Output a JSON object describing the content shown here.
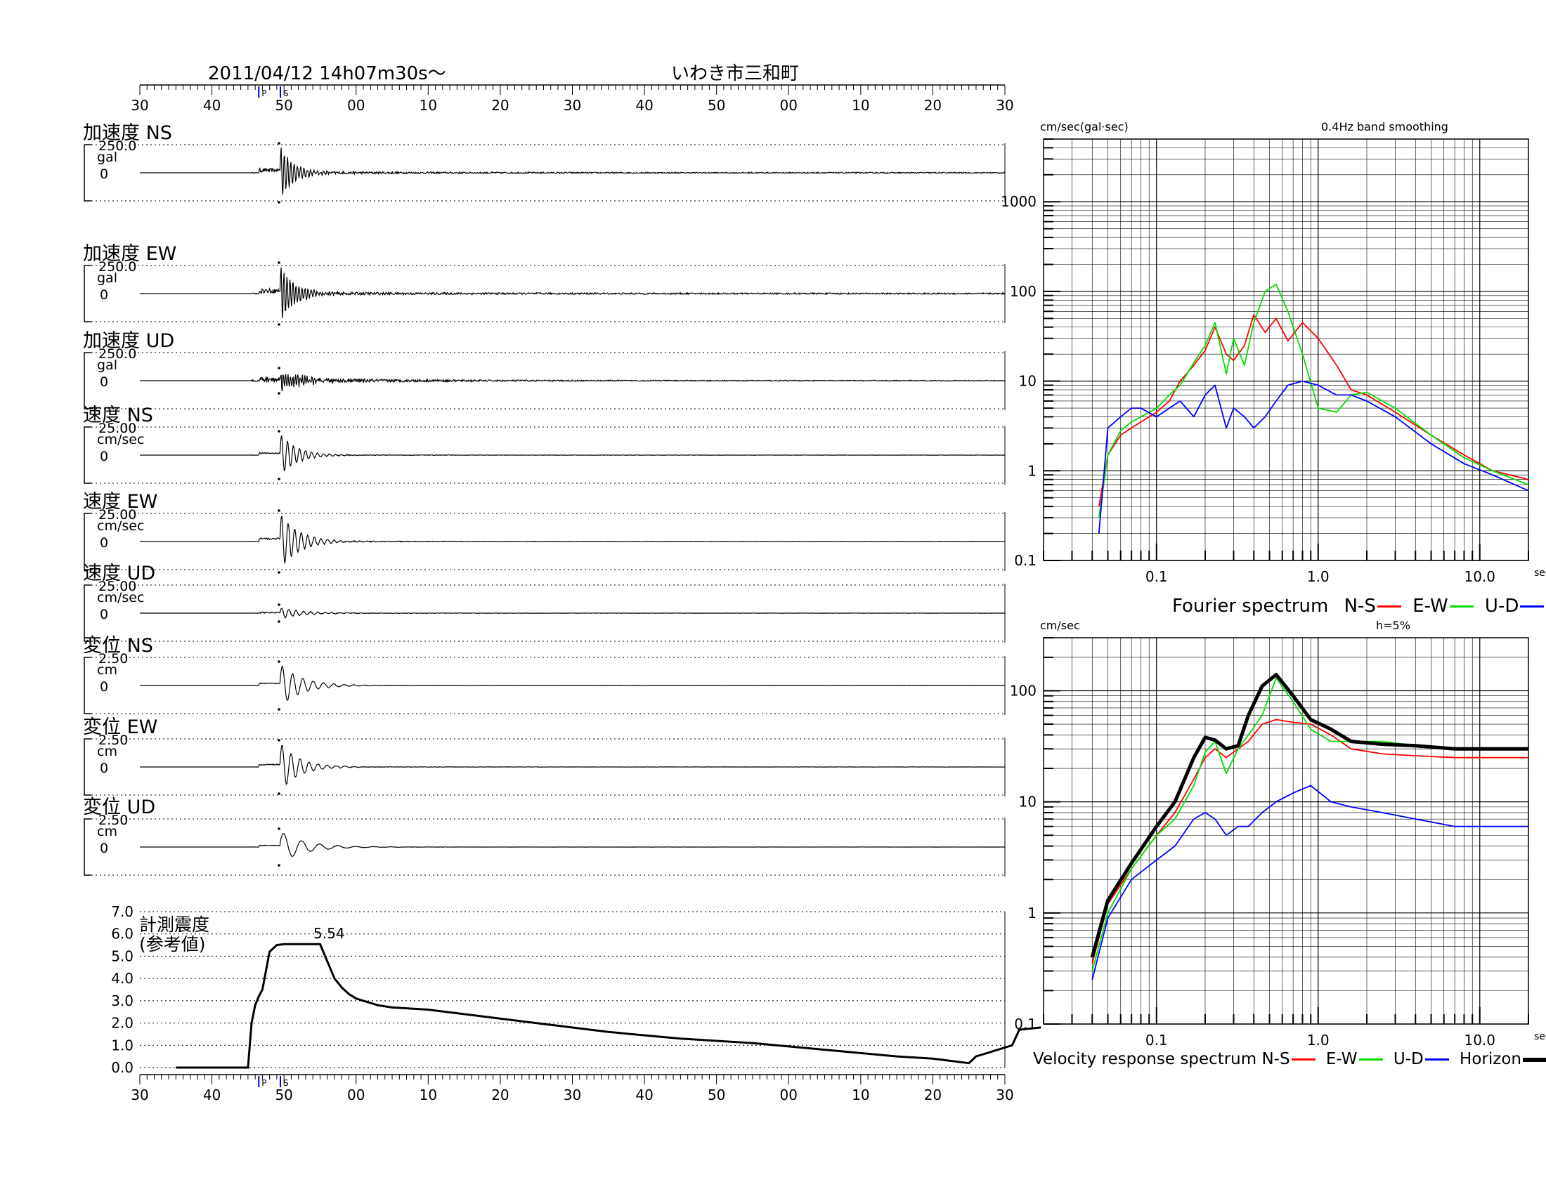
{
  "header": {
    "datetime": "2011/04/12  14h07m30s〜",
    "station": "いわき市三和町"
  },
  "time_axis": {
    "tick_labels": [
      "30",
      "40",
      "50",
      "00",
      "10",
      "20",
      "30",
      "40",
      "50",
      "00",
      "10",
      "20",
      "30"
    ],
    "p_marker": "P",
    "s_marker": "S"
  },
  "traces": [
    {
      "label": "加速度 NS",
      "scale": "250.0",
      "unit": "gal",
      "zero": "0"
    },
    {
      "label": "加速度 EW",
      "scale": "250.0",
      "unit": "gal",
      "zero": "0"
    },
    {
      "label": "加速度 UD",
      "scale": "250.0",
      "unit": "gal",
      "zero": "0"
    },
    {
      "label": "速度 NS",
      "scale": "25.00",
      "unit": "cm/sec",
      "zero": "0"
    },
    {
      "label": "速度 EW",
      "scale": "25.00",
      "unit": "cm/sec",
      "zero": "0"
    },
    {
      "label": "速度 UD",
      "scale": "25.00",
      "unit": "cm/sec",
      "zero": "0"
    },
    {
      "label": "変位 NS",
      "scale": "2.50",
      "unit": "cm",
      "zero": "0"
    },
    {
      "label": "変位 EW",
      "scale": "2.50",
      "unit": "cm",
      "zero": "0"
    },
    {
      "label": "変位 UD",
      "scale": "2.50",
      "unit": "cm",
      "zero": "0"
    }
  ],
  "intensity": {
    "label_line1": "計測震度",
    "label_line2": "(参考値)",
    "peak_label": "5.54",
    "y_ticks": [
      "7.0",
      "6.0",
      "5.0",
      "4.0",
      "3.0",
      "2.0",
      "1.0",
      "0.0"
    ]
  },
  "fourier": {
    "ylabel": "cm/sec(gal·sec)",
    "note": "0.4Hz band smoothing",
    "y_ticks": [
      "1000",
      "100",
      "10",
      "1",
      "0.1"
    ],
    "x_ticks": [
      "0.1",
      "1.0",
      "10.0"
    ],
    "x_unit": "sec",
    "legend_title": "Fourier spectrum",
    "legend": [
      "N-S",
      "E-W",
      "U-D"
    ]
  },
  "response": {
    "ylabel": "cm/sec",
    "note": "h=5%",
    "y_ticks": [
      "100",
      "10",
      "1",
      "0.1"
    ],
    "x_ticks": [
      "0.1",
      "1.0",
      "10.0"
    ],
    "x_unit": "sec",
    "legend_title": "Velocity response spectrum",
    "legend": [
      "N-S",
      "E-W",
      "U-D",
      "Horizon"
    ]
  },
  "colors": {
    "ns": "#ff0000",
    "ew": "#00e000",
    "ud": "#0000ff",
    "horizon": "#000000",
    "markers": "#0000cc"
  },
  "chart_data": [
    {
      "type": "line",
      "title": "Fourier spectrum",
      "ylabel": "cm/sec(gal·sec)",
      "xlabel": "sec",
      "xscale": "log",
      "yscale": "log",
      "xlim": [
        0.02,
        20
      ],
      "ylim": [
        0.1,
        5000
      ],
      "series": [
        {
          "name": "N-S",
          "x": [
            0.044,
            0.05,
            0.06,
            0.07,
            0.08,
            0.1,
            0.12,
            0.14,
            0.17,
            0.2,
            0.23,
            0.27,
            0.3,
            0.35,
            0.4,
            0.47,
            0.55,
            0.65,
            0.8,
            1.0,
            1.3,
            1.6,
            2,
            3,
            5,
            8,
            12,
            20
          ],
          "y": [
            0.4,
            1.5,
            2.5,
            3.0,
            3.5,
            4.5,
            6,
            10,
            15,
            22,
            40,
            20,
            17,
            25,
            55,
            35,
            50,
            28,
            45,
            30,
            15,
            8,
            7,
            4.5,
            2.5,
            1.5,
            1.0,
            0.8
          ]
        },
        {
          "name": "E-W",
          "x": [
            0.044,
            0.05,
            0.06,
            0.07,
            0.08,
            0.1,
            0.12,
            0.14,
            0.17,
            0.2,
            0.23,
            0.27,
            0.3,
            0.35,
            0.4,
            0.47,
            0.55,
            0.65,
            0.8,
            1.0,
            1.3,
            1.6,
            2,
            3,
            5,
            8,
            12,
            20
          ],
          "y": [
            0.3,
            1.5,
            2.8,
            3.5,
            4,
            5,
            7,
            9,
            16,
            25,
            45,
            12,
            30,
            15,
            45,
            100,
            120,
            60,
            20,
            5,
            4.5,
            7,
            7.5,
            5,
            2.5,
            1.4,
            1.0,
            0.7
          ]
        },
        {
          "name": "U-D",
          "x": [
            0.044,
            0.05,
            0.06,
            0.07,
            0.08,
            0.1,
            0.12,
            0.14,
            0.17,
            0.2,
            0.23,
            0.27,
            0.3,
            0.35,
            0.4,
            0.47,
            0.55,
            0.65,
            0.8,
            1.0,
            1.3,
            1.6,
            2,
            3,
            5,
            8,
            12,
            20
          ],
          "y": [
            0.2,
            3,
            4,
            5,
            5,
            4,
            5,
            6,
            4,
            7,
            9,
            3,
            5,
            4,
            3,
            4,
            6,
            9,
            10,
            9,
            7,
            7,
            6,
            4,
            2,
            1.2,
            0.9,
            0.6
          ]
        }
      ]
    },
    {
      "type": "line",
      "title": "Velocity response spectrum",
      "ylabel": "cm/sec",
      "xlabel": "sec",
      "note": "h=5%",
      "xscale": "log",
      "yscale": "log",
      "xlim": [
        0.02,
        20
      ],
      "ylim": [
        0.1,
        300
      ],
      "series": [
        {
          "name": "N-S",
          "x": [
            0.04,
            0.05,
            0.07,
            0.1,
            0.13,
            0.17,
            0.2,
            0.23,
            0.27,
            0.32,
            0.37,
            0.45,
            0.55,
            0.7,
            0.9,
            1.2,
            1.6,
            2.5,
            4,
            7,
            20
          ],
          "y": [
            0.35,
            1.2,
            2.5,
            5,
            8,
            16,
            25,
            30,
            25,
            30,
            35,
            50,
            55,
            52,
            50,
            40,
            30,
            27,
            26,
            25,
            25
          ]
        },
        {
          "name": "E-W",
          "x": [
            0.04,
            0.05,
            0.07,
            0.1,
            0.13,
            0.17,
            0.2,
            0.23,
            0.27,
            0.32,
            0.37,
            0.45,
            0.55,
            0.7,
            0.9,
            1.2,
            1.6,
            2.5,
            4,
            7,
            20
          ],
          "y": [
            0.3,
            1.0,
            2.5,
            5,
            7,
            14,
            28,
            35,
            18,
            30,
            40,
            60,
            130,
            80,
            45,
            35,
            35,
            35,
            32,
            30,
            30
          ]
        },
        {
          "name": "U-D",
          "x": [
            0.04,
            0.05,
            0.07,
            0.1,
            0.13,
            0.17,
            0.2,
            0.23,
            0.27,
            0.32,
            0.37,
            0.45,
            0.55,
            0.7,
            0.9,
            1.2,
            1.6,
            2.5,
            4,
            7,
            20
          ],
          "y": [
            0.25,
            0.9,
            2.0,
            3,
            4,
            7,
            8,
            7,
            5,
            6,
            6,
            8,
            10,
            12,
            14,
            10,
            9,
            8,
            7,
            6,
            6
          ]
        },
        {
          "name": "Horizon",
          "x": [
            0.04,
            0.05,
            0.07,
            0.1,
            0.13,
            0.17,
            0.2,
            0.23,
            0.27,
            0.32,
            0.37,
            0.45,
            0.55,
            0.7,
            0.9,
            1.2,
            1.6,
            2.5,
            4,
            7,
            20
          ],
          "y": [
            0.4,
            1.3,
            2.8,
            6,
            10,
            25,
            38,
            36,
            30,
            32,
            60,
            110,
            140,
            90,
            55,
            45,
            35,
            33,
            32,
            30,
            30
          ]
        }
      ]
    },
    {
      "type": "line",
      "title": "計測震度",
      "xlabel": "",
      "ylabel": "",
      "ylim": [
        0,
        7
      ],
      "peak": 5.54,
      "x": [
        0,
        5,
        10,
        10.5,
        11,
        11.5,
        12,
        13,
        14,
        15,
        20,
        22,
        23,
        24,
        25,
        26,
        27,
        28,
        30,
        35,
        40,
        50,
        60,
        70,
        80,
        90,
        100,
        105,
        110,
        111,
        115,
        116,
        117,
        120
      ],
      "y": [
        0,
        0,
        0,
        2,
        2.8,
        3.2,
        3.5,
        5.2,
        5.5,
        5.54,
        5.54,
        4.0,
        3.6,
        3.3,
        3.1,
        3.0,
        2.9,
        2.8,
        2.7,
        2.6,
        2.4,
        2.0,
        1.6,
        1.3,
        1.1,
        0.8,
        0.5,
        0.4,
        0.2,
        0.5,
        0.9,
        1.0,
        1.7,
        1.8
      ]
    }
  ]
}
